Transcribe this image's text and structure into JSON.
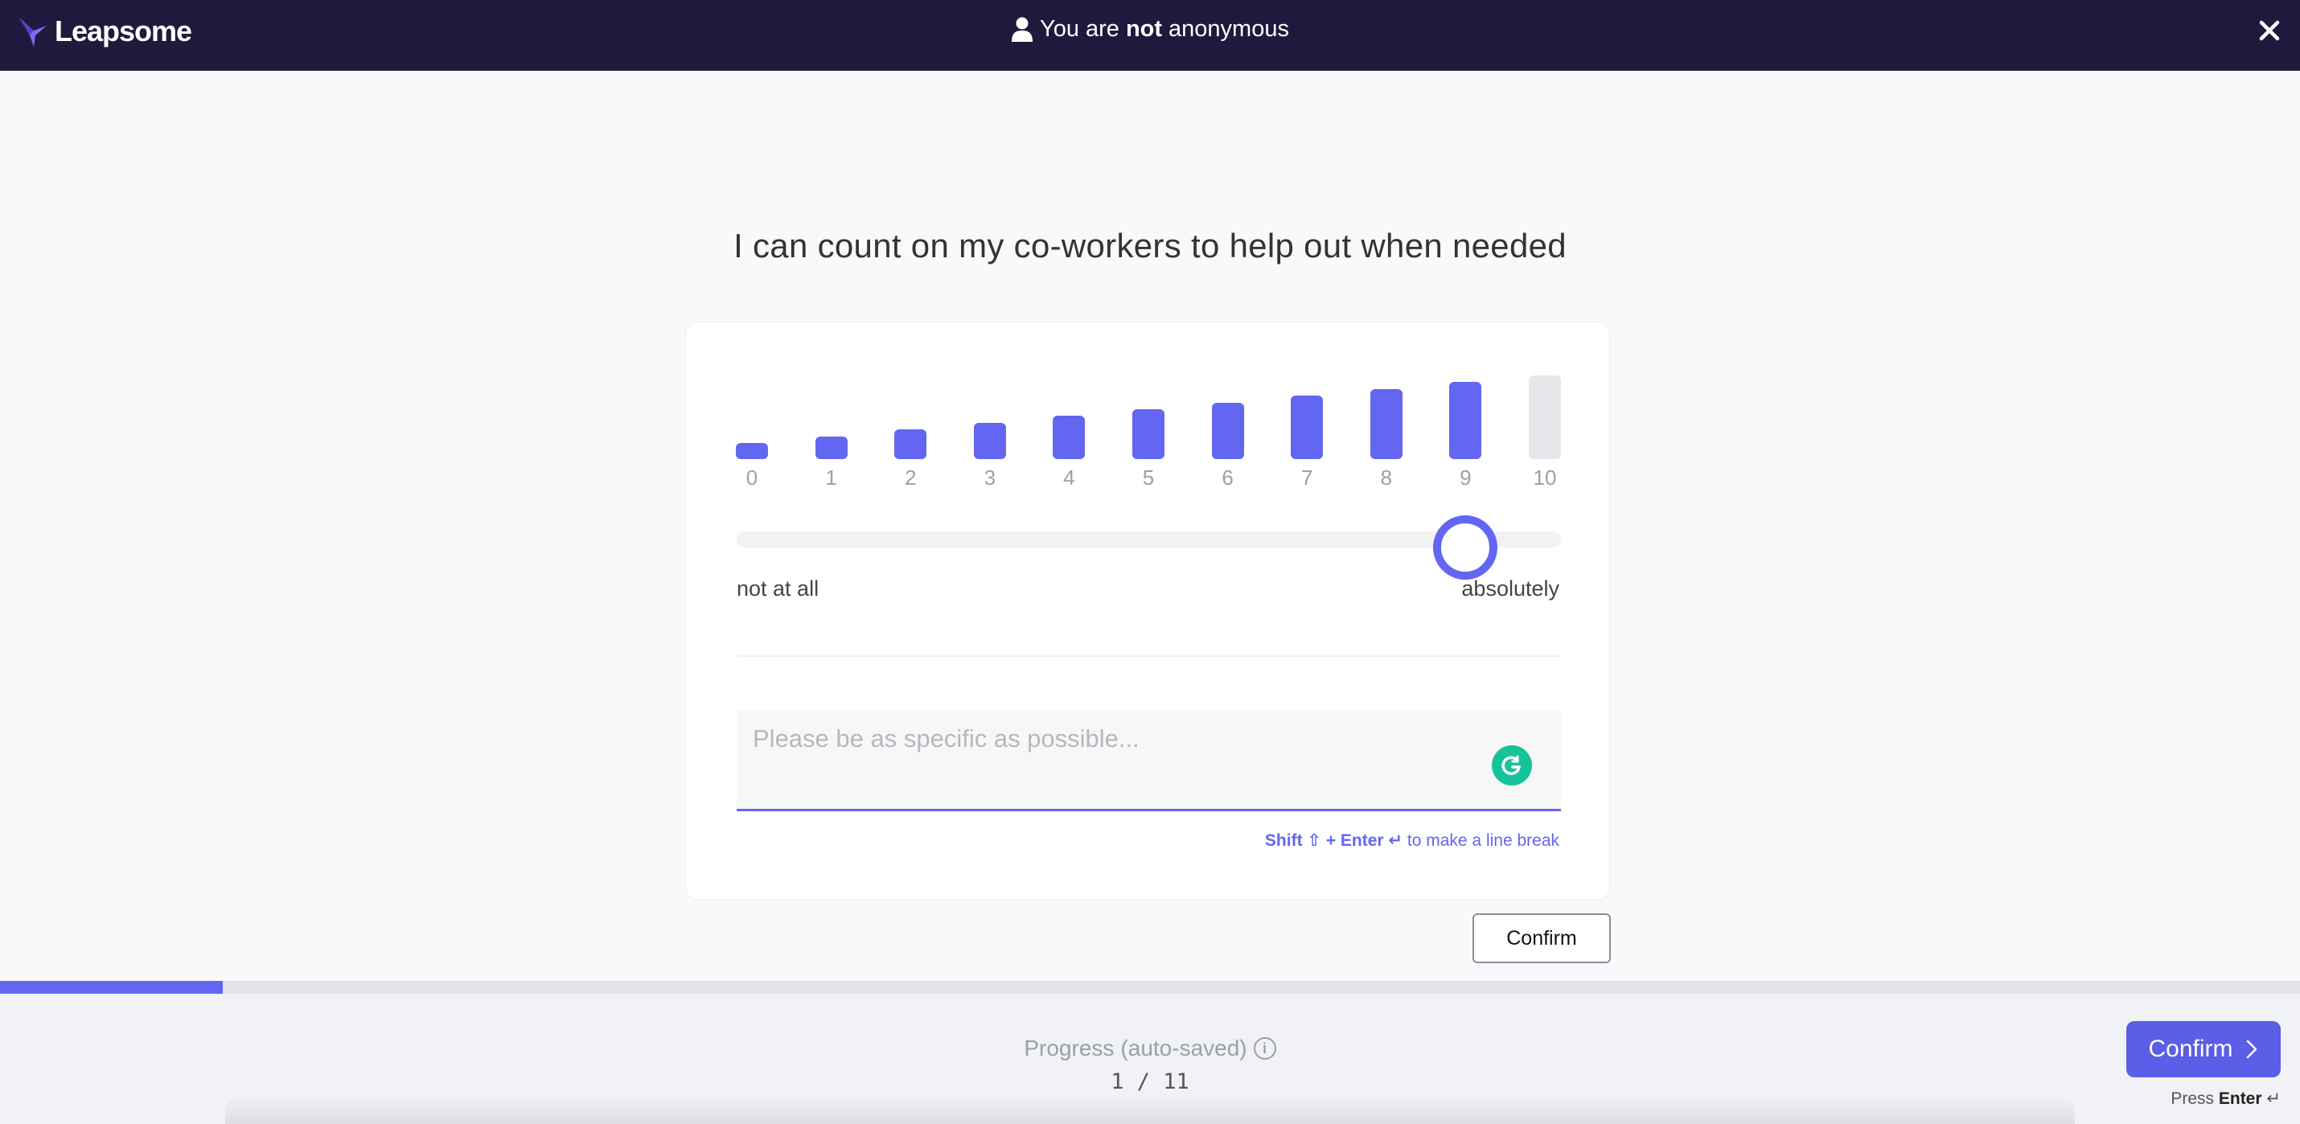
{
  "header": {
    "logo_text": "Leapsome",
    "anon_prefix": "You are",
    "anon_strong": "not",
    "anon_suffix": "anonymous",
    "close_icon": "close-icon"
  },
  "question": "I can count on my co-workers to help out when needed",
  "scale": {
    "labels": [
      "0",
      "1",
      "2",
      "3",
      "4",
      "5",
      "6",
      "7",
      "8",
      "9",
      "10"
    ],
    "selected_value": 9,
    "min_label": "not at all",
    "max_label": "absolutely",
    "accent_color": "#6366f1",
    "inactive_color": "#e6e7eb"
  },
  "comment": {
    "placeholder": "Please be as specific as possible...",
    "value": "",
    "hint_keys": "Shift ⇧ + Enter ↵",
    "hint_text": "to make a line break"
  },
  "card_confirm_label": "Confirm",
  "footer": {
    "progress_label": "Progress",
    "autosaved_label": "(auto-saved)",
    "current": 1,
    "total": 11,
    "count_text": "1 / 11",
    "progress_fraction": 0.097,
    "confirm_label": "Confirm",
    "press_prefix": "Press",
    "press_key": "Enter",
    "press_symbol": "↵"
  },
  "colors": {
    "header_bg": "#1f1a3d",
    "primary": "#5b5ee6",
    "grammarly": "#15c39a"
  }
}
